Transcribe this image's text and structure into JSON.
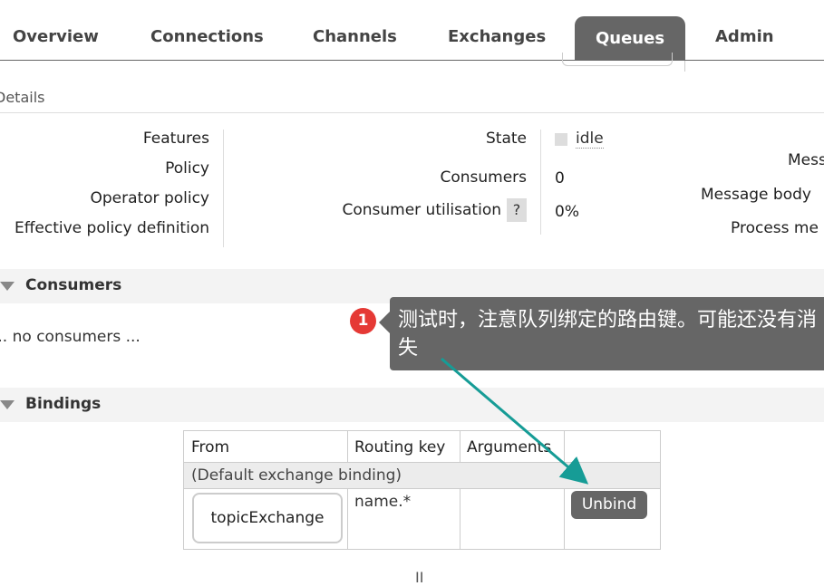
{
  "nav": {
    "tabs": [
      "Overview",
      "Connections",
      "Channels",
      "Exchanges",
      "Admin"
    ],
    "active_tab": "Queues"
  },
  "details": {
    "title": "Details",
    "left_labels": [
      "Features",
      "Policy",
      "Operator policy",
      "Effective policy definition"
    ],
    "state_label": "State",
    "state_value": "idle",
    "consumers_label": "Consumers",
    "consumers_value": "0",
    "utilisation_label": "Consumer utilisation",
    "utilisation_help": "?",
    "utilisation_value": "0%",
    "right_labels": [
      "Mess",
      "Message body",
      "Process me"
    ]
  },
  "consumers": {
    "title": "Consumers",
    "empty_text": "... no consumers ..."
  },
  "bindings": {
    "title": "Bindings",
    "columns": [
      "From",
      "Routing key",
      "Arguments"
    ],
    "default_row": "(Default exchange binding)",
    "row": {
      "from": "topicExchange",
      "routing_key": "name.*",
      "action": "Unbind"
    }
  },
  "pager": "II",
  "annotation": {
    "number": "1",
    "text": "测试时，注意队列绑定的路由键。可能还没有消失",
    "color": "#666666",
    "badge_color": "#e53935",
    "arrow_color": "#169c96"
  }
}
